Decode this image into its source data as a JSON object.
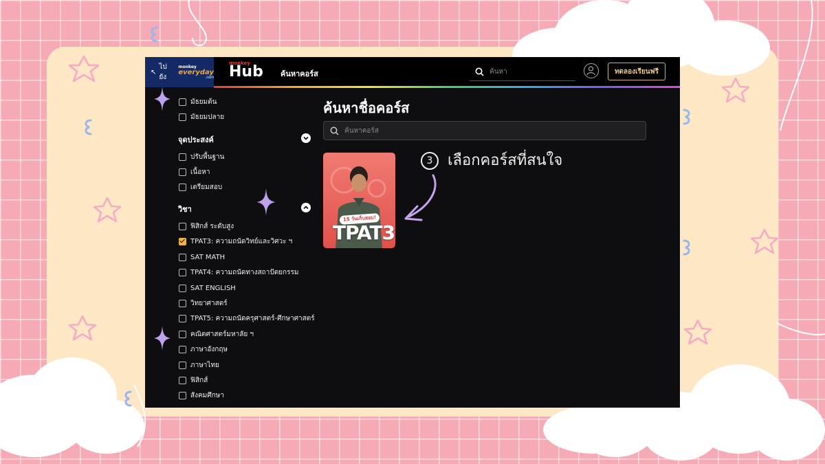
{
  "app": {
    "back_label": "ไปยัง",
    "back_logo_top": "monkey",
    "back_logo_main": "everyday",
    "back_logo_sub": ".com",
    "hub_logo_top": "monkey",
    "hub_logo_main": "Hub",
    "nav_link": "ค้นหาคอร์ส",
    "search_placeholder": "ค้นหา",
    "trial_button": "ทดลองเรียนฟรี"
  },
  "sidebar": {
    "level_options": [
      {
        "label": "มัธยมต้น",
        "checked": false
      },
      {
        "label": "มัธยมปลาย",
        "checked": false
      }
    ],
    "purpose": {
      "title": "จุดประสงค์",
      "options": [
        {
          "label": "ปรับพื้นฐาน",
          "checked": false
        },
        {
          "label": "เนื้อหา",
          "checked": false
        },
        {
          "label": "เตรียมสอบ",
          "checked": false
        }
      ]
    },
    "subject": {
      "title": "วิชา",
      "options": [
        {
          "label": "ฟิสิกส์ ระดับสูง",
          "checked": false
        },
        {
          "label": "TPAT3: ความถนัดวิทย์และวิศวะ ฯ",
          "checked": true
        },
        {
          "label": "SAT MATH",
          "checked": false
        },
        {
          "label": "TPAT4: ความถนัดทางสถาปัตยกรรม",
          "checked": false
        },
        {
          "label": "SAT ENGLISH",
          "checked": false
        },
        {
          "label": "วิทยาศาสตร์",
          "checked": false
        },
        {
          "label": "TPAT5: ความถนัดครุศาสตร์-ศึกษาศาสตร์",
          "checked": false
        },
        {
          "label": "คณิตศาสตร์มหาลัย ฯ",
          "checked": false
        },
        {
          "label": "ภาษาอังกฤษ",
          "checked": false
        },
        {
          "label": "ภาษาไทย",
          "checked": false
        },
        {
          "label": "ฟิสิกส์",
          "checked": false
        },
        {
          "label": "สังคมศึกษา",
          "checked": false
        }
      ]
    }
  },
  "main": {
    "title": "ค้นหาชื่อคอร์ส",
    "search_placeholder": "ค้นหาคอร์ส",
    "card": {
      "badge": "15 วันเก็บสอบ!",
      "course": "TPAT3"
    }
  },
  "annotation": {
    "number": "3",
    "text": "เลือกคอร์สที่สนใจ"
  },
  "colors": {
    "accent": "#f0b440",
    "frame": "#fde7c4",
    "background": "#f6aab5",
    "app_bg": "#0e0e10"
  }
}
